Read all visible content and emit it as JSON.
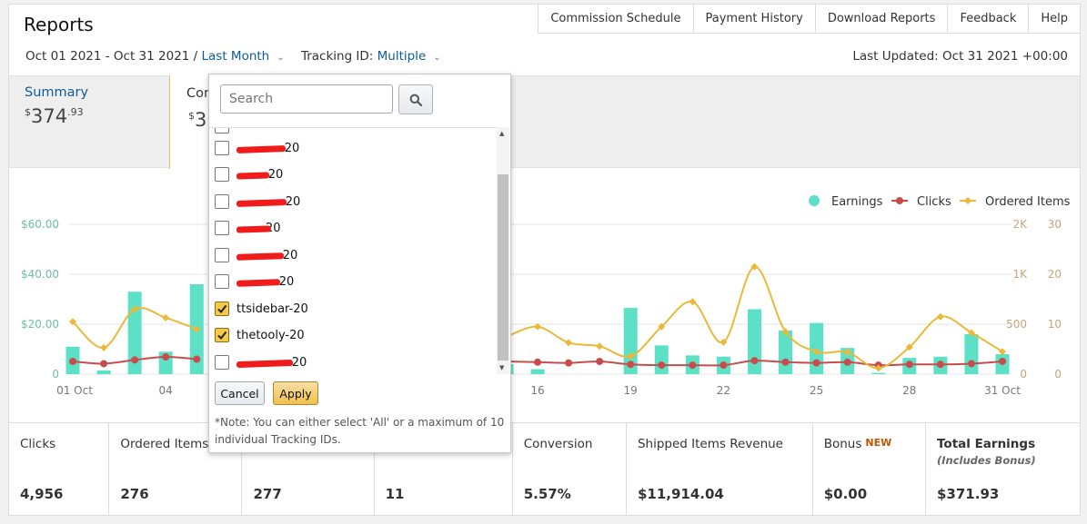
{
  "header": {
    "title": "Reports",
    "nav": [
      "Commission Schedule",
      "Payment History",
      "Download Reports",
      "Feedback",
      "Help"
    ],
    "date_range": "Oct 01 2021 - Oct 31 2021 /",
    "date_preset": "Last Month",
    "tracking_label": "Tracking ID:",
    "tracking_value": "Multiple",
    "last_updated": "Last Updated: Oct 31 2021 +00:00"
  },
  "summary_tabs": [
    {
      "label": "Summary",
      "currency": "$",
      "whole": "374",
      "cents": ".93"
    },
    {
      "label": "Con",
      "currency": "$",
      "whole": "3"
    }
  ],
  "dropdown": {
    "search_placeholder": "Search",
    "items": [
      {
        "label": "-20",
        "checked": false
      },
      {
        "label": "-20",
        "checked": false
      },
      {
        "label": "-20",
        "checked": false
      },
      {
        "label": "20",
        "checked": false
      },
      {
        "label": "-20",
        "checked": false
      },
      {
        "label": "-20",
        "checked": false
      },
      {
        "label": "ttsidebar-20",
        "checked": true
      },
      {
        "label": "thetooly-20",
        "checked": true
      },
      {
        "label": "-20",
        "checked": false
      }
    ],
    "cancel_label": "Cancel",
    "apply_label": "Apply",
    "note": "*Note: You can either select 'All' or a maximum of 10 individual Tracking IDs."
  },
  "chart_data": {
    "type": "bar",
    "legend": [
      {
        "name": "Earnings",
        "color": "#5ce1c6"
      },
      {
        "name": "Clicks",
        "color": "#c94c4c"
      },
      {
        "name": "Ordered Items",
        "color": "#ebb93a"
      }
    ],
    "legend_position": "top-right",
    "x_ticks": [
      "01 Oct",
      "04",
      "16",
      "19",
      "22",
      "25",
      "28",
      "31 Oct"
    ],
    "y_left_ticks": [
      "$60.00",
      "$40.00",
      "$20.00",
      "0"
    ],
    "y_right1_ticks": [
      "2K",
      "1K",
      "500",
      "0"
    ],
    "y_right2_ticks": [
      "30",
      "20",
      "10",
      "0"
    ],
    "grid": true,
    "days": [
      1,
      2,
      3,
      4,
      5,
      6,
      7,
      8,
      9,
      10,
      11,
      12,
      13,
      14,
      15,
      16,
      17,
      18,
      19,
      20,
      21,
      22,
      23,
      24,
      25,
      26,
      27,
      28,
      29,
      30,
      31
    ],
    "series": [
      {
        "name": "Earnings",
        "axis": "left",
        "unit": "$",
        "values": [
          11,
          1.5,
          33,
          9,
          36,
          null,
          null,
          null,
          null,
          null,
          null,
          null,
          null,
          null,
          4,
          2,
          null,
          null,
          26.5,
          11.5,
          7.5,
          7,
          26,
          17.5,
          20.5,
          10.5,
          0.5,
          6.5,
          7,
          16,
          8
        ]
      },
      {
        "name": "Clicks",
        "axis": "right1",
        "values": [
          170,
          140,
          190,
          230,
          200,
          null,
          null,
          null,
          null,
          null,
          null,
          null,
          null,
          null,
          170,
          160,
          150,
          170,
          130,
          120,
          120,
          120,
          180,
          160,
          150,
          160,
          120,
          130,
          130,
          140,
          170
        ]
      },
      {
        "name": "Ordered Items",
        "axis": "right2",
        "values": [
          10.5,
          5.3,
          13,
          11.3,
          9,
          null,
          null,
          null,
          null,
          null,
          null,
          null,
          null,
          null,
          7.5,
          9.5,
          6.3,
          5.6,
          3.6,
          9.5,
          14.5,
          6.4,
          21.5,
          8.5,
          4.5,
          4.4,
          1.2,
          5.4,
          11.5,
          8.3,
          4.5
        ]
      }
    ]
  },
  "stats": [
    {
      "label": "Clicks",
      "value": "4,956"
    },
    {
      "label": "Ordered Items",
      "value": "276"
    },
    {
      "label": "",
      "value": "277"
    },
    {
      "label": "",
      "value": "11"
    },
    {
      "label": "Conversion",
      "value": "5.57%"
    },
    {
      "label": "Shipped Items Revenue",
      "value": "$11,914.04"
    },
    {
      "label": "Bonus",
      "badge": "NEW",
      "value": "$0.00"
    },
    {
      "label": "Total Earnings",
      "sub": "(Includes Bonus)",
      "value": "$371.93"
    }
  ]
}
